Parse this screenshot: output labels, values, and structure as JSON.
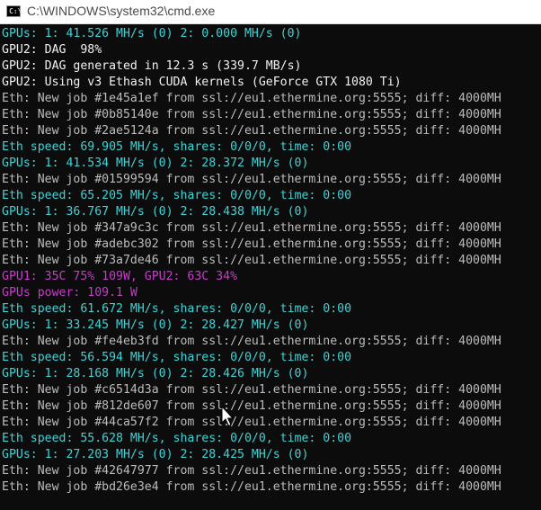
{
  "window": {
    "title": "C:\\WINDOWS\\system32\\cmd.exe",
    "icon": "cmd-icon",
    "icon_text": "C:\\"
  },
  "console": {
    "colors": {
      "cyan": "#3ad5d8",
      "white": "#f2f2f2",
      "magenta": "#c93acd",
      "gray": "#bcbcbc",
      "background": "#0c0c0c"
    },
    "lines": [
      {
        "text": "GPUs: 1: 41.526 MH/s (0) 2: 0.000 MH/s (0)",
        "color": "cyan"
      },
      {
        "text": "GPU2: DAG  98%",
        "color": "white"
      },
      {
        "text": "GPU2: DAG generated in 12.3 s (339.7 MB/s)",
        "color": "white"
      },
      {
        "text": "GPU2: Using v3 Ethash CUDA kernels (GeForce GTX 1080 Ti)",
        "color": "white"
      },
      {
        "text": "Eth: New job #1e45a1ef from ssl://eu1.ethermine.org:5555; diff: 4000MH",
        "color": "gray"
      },
      {
        "text": "Eth: New job #0b85140e from ssl://eu1.ethermine.org:5555; diff: 4000MH",
        "color": "gray"
      },
      {
        "text": "Eth: New job #2ae5124a from ssl://eu1.ethermine.org:5555; diff: 4000MH",
        "color": "gray"
      },
      {
        "text": "Eth speed: 69.905 MH/s, shares: 0/0/0, time: 0:00",
        "color": "cyan"
      },
      {
        "text": "GPUs: 1: 41.534 MH/s (0) 2: 28.372 MH/s (0)",
        "color": "cyan"
      },
      {
        "text": "Eth: New job #01599594 from ssl://eu1.ethermine.org:5555; diff: 4000MH",
        "color": "gray"
      },
      {
        "text": "Eth speed: 65.205 MH/s, shares: 0/0/0, time: 0:00",
        "color": "cyan"
      },
      {
        "text": "GPUs: 1: 36.767 MH/s (0) 2: 28.438 MH/s (0)",
        "color": "cyan"
      },
      {
        "text": "Eth: New job #347a9c3c from ssl://eu1.ethermine.org:5555; diff: 4000MH",
        "color": "gray"
      },
      {
        "text": "Eth: New job #adebc302 from ssl://eu1.ethermine.org:5555; diff: 4000MH",
        "color": "gray"
      },
      {
        "text": "Eth: New job #73a7de46 from ssl://eu1.ethermine.org:5555; diff: 4000MH",
        "color": "gray"
      },
      {
        "text": "GPU1: 35C 75% 109W, GPU2: 63C 34%",
        "color": "magenta"
      },
      {
        "text": "GPUs power: 109.1 W",
        "color": "magenta"
      },
      {
        "text": "Eth speed: 61.672 MH/s, shares: 0/0/0, time: 0:00",
        "color": "cyan"
      },
      {
        "text": "GPUs: 1: 33.245 MH/s (0) 2: 28.427 MH/s (0)",
        "color": "cyan"
      },
      {
        "text": "Eth: New job #fe4eb3fd from ssl://eu1.ethermine.org:5555; diff: 4000MH",
        "color": "gray"
      },
      {
        "text": "Eth speed: 56.594 MH/s, shares: 0/0/0, time: 0:00",
        "color": "cyan"
      },
      {
        "text": "GPUs: 1: 28.168 MH/s (0) 2: 28.426 MH/s (0)",
        "color": "cyan"
      },
      {
        "text": "Eth: New job #c6514d3a from ssl://eu1.ethermine.org:5555; diff: 4000MH",
        "color": "gray"
      },
      {
        "text": "Eth: New job #812de607 from ssl://eu1.ethermine.org:5555; diff: 4000MH",
        "color": "gray"
      },
      {
        "text": "Eth: New job #44ca57f2 from ssl://eu1.ethermine.org:5555; diff: 4000MH",
        "color": "gray"
      },
      {
        "text": "Eth speed: 55.628 MH/s, shares: 0/0/0, time: 0:00",
        "color": "cyan"
      },
      {
        "text": "GPUs: 1: 27.203 MH/s (0) 2: 28.425 MH/s (0)",
        "color": "cyan"
      },
      {
        "text": "Eth: New job #42647977 from ssl://eu1.ethermine.org:5555; diff: 4000MH",
        "color": "gray"
      },
      {
        "text": "Eth: New job #bd26e3e4 from ssl://eu1.ethermine.org:5555; diff: 4000MH",
        "color": "gray"
      }
    ]
  },
  "cursor": {
    "icon": "mouse-pointer-icon"
  }
}
